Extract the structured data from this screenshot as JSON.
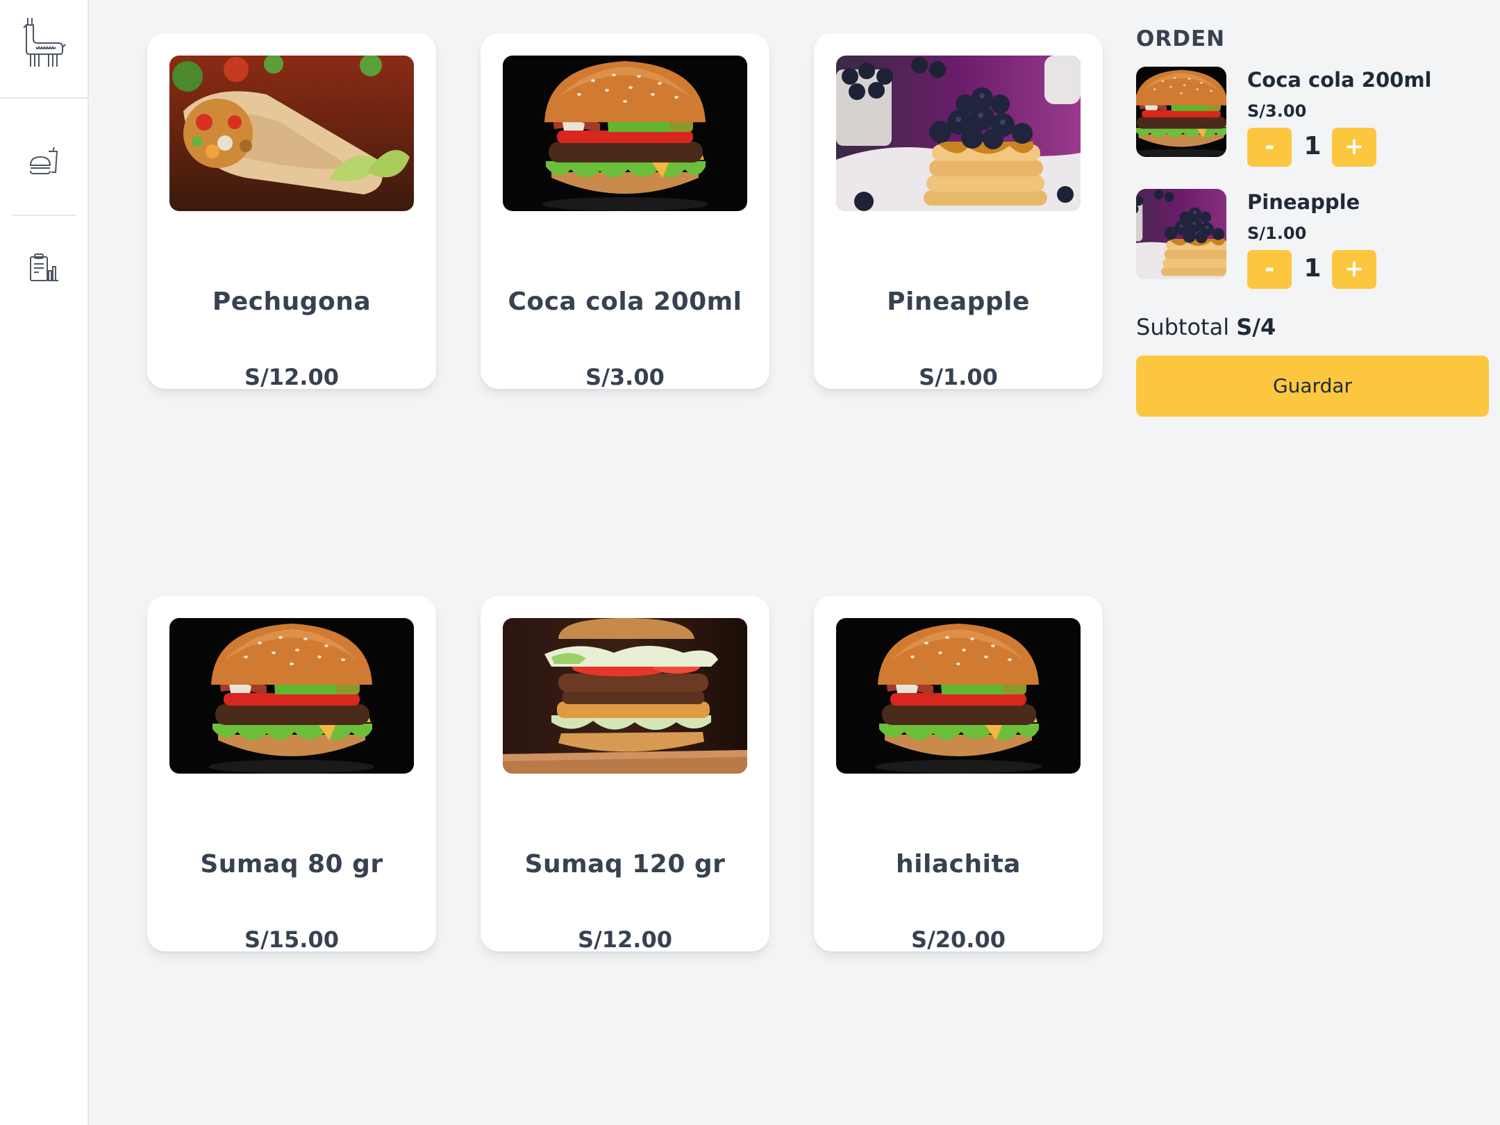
{
  "sidebar": {
    "logo_icon": "llama-logo-icon",
    "nav": [
      {
        "icon": "food-menu-icon"
      },
      {
        "icon": "clipboard-chart-icon"
      }
    ]
  },
  "products": [
    {
      "name": "Pechugona",
      "price": "S/12.00",
      "image": "burrito"
    },
    {
      "name": "Coca cola 200ml",
      "price": "S/3.00",
      "image": "burger"
    },
    {
      "name": "Pineapple",
      "price": "S/1.00",
      "image": "pancakes"
    },
    {
      "name": "Sumaq 80 gr",
      "price": "S/15.00",
      "image": "burger"
    },
    {
      "name": "Sumaq 120 gr",
      "price": "S/12.00",
      "image": "tall-burger"
    },
    {
      "name": "hilachita",
      "price": "S/20.00",
      "image": "burger"
    }
  ],
  "order": {
    "title": "ORDEN",
    "items": [
      {
        "name": "Coca cola 200ml",
        "price": "S/3.00",
        "qty": "1",
        "minus": "-",
        "plus": "+",
        "image": "burger"
      },
      {
        "name": "Pineapple",
        "price": "S/1.00",
        "qty": "1",
        "minus": "-",
        "plus": "+",
        "image": "pancakes"
      }
    ],
    "subtotal_label": "Subtotal",
    "subtotal_value": "S/4",
    "save_label": "Guardar"
  },
  "colors": {
    "accent": "#fcc73f",
    "background": "#f3f4f6",
    "card": "#ffffff",
    "text": "#374151"
  }
}
